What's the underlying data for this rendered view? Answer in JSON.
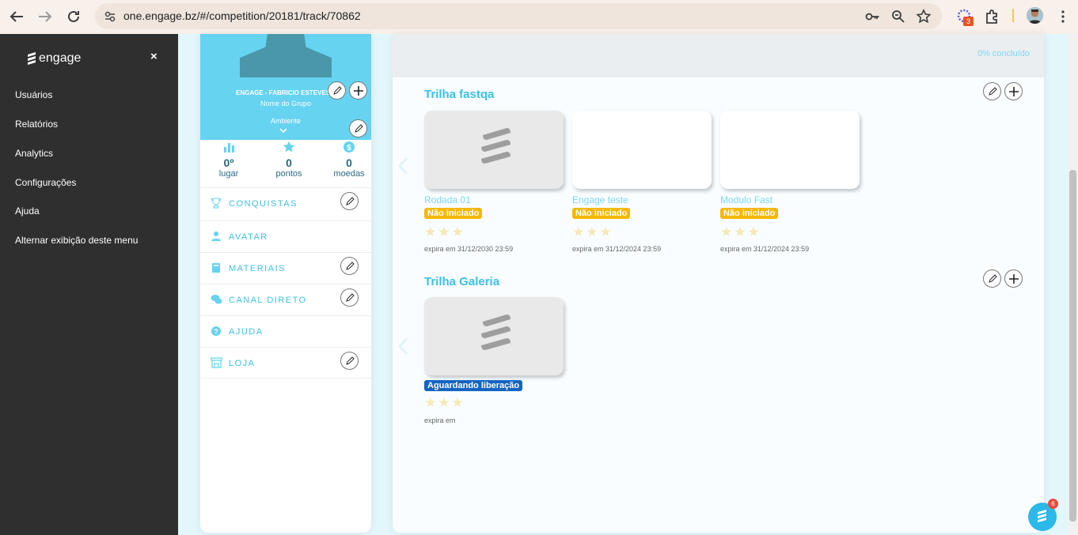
{
  "browser": {
    "url": "one.engage.bz/#/competition/20181/track/70862",
    "extension_badge": "3"
  },
  "menu": {
    "logo": "engage",
    "close": "×",
    "items": [
      "Usuários",
      "Relatórios",
      "Analytics",
      "Configurações",
      "Ajuda",
      "Alternar exibição deste menu"
    ]
  },
  "profile": {
    "group_name": "ENGAGE - FABRICIO ESTEVES",
    "group_sub": "Nome do Grupo",
    "ambiente": "Ambiente",
    "stats": [
      {
        "value": "0º",
        "label": "lugar",
        "icon": "bar-chart-icon"
      },
      {
        "value": "0",
        "label": "pontos",
        "icon": "star-icon"
      },
      {
        "value": "0",
        "label": "moedas",
        "icon": "coin-icon"
      }
    ],
    "items": [
      {
        "label": "CONQUISTAS",
        "icon": "trophy-icon",
        "editable": true
      },
      {
        "label": "AVATAR",
        "icon": "user-icon",
        "editable": false
      },
      {
        "label": "MATERIAIS",
        "icon": "book-icon",
        "editable": true
      },
      {
        "label": "CANAL DIRETO",
        "icon": "chat-icon",
        "editable": true
      },
      {
        "label": "AJUDA",
        "icon": "question-icon",
        "editable": false
      },
      {
        "label": "LOJA",
        "icon": "store-icon",
        "editable": true
      }
    ]
  },
  "main": {
    "progress": "0% concluído",
    "tracks": [
      {
        "title": "Trilha fastqa",
        "cards": [
          {
            "name": "Rodada 01",
            "status": "Não iniciado",
            "expira": "expira em 31/12/2030 23:59",
            "placeholder": true
          },
          {
            "name": "Engage teste",
            "status": "Não iniciado",
            "expira": "expira em 31/12/2024 23:59",
            "placeholder": false
          },
          {
            "name": "Modulo Fast",
            "status": "Não iniciado",
            "expira": "expira em 31/12/2024 23:59",
            "placeholder": false
          }
        ]
      },
      {
        "title": "Trilha Galeria",
        "cards": [
          {
            "name": "",
            "status": "Aguardando liberação",
            "expira": "expira em",
            "placeholder": true
          }
        ]
      }
    ]
  },
  "chat_badge": "6",
  "colors": {
    "accent": "#66d3f0",
    "status_yellow": "#f5b800",
    "status_blue": "#1565c0",
    "sidebar_bg": "#2f2f2f"
  }
}
